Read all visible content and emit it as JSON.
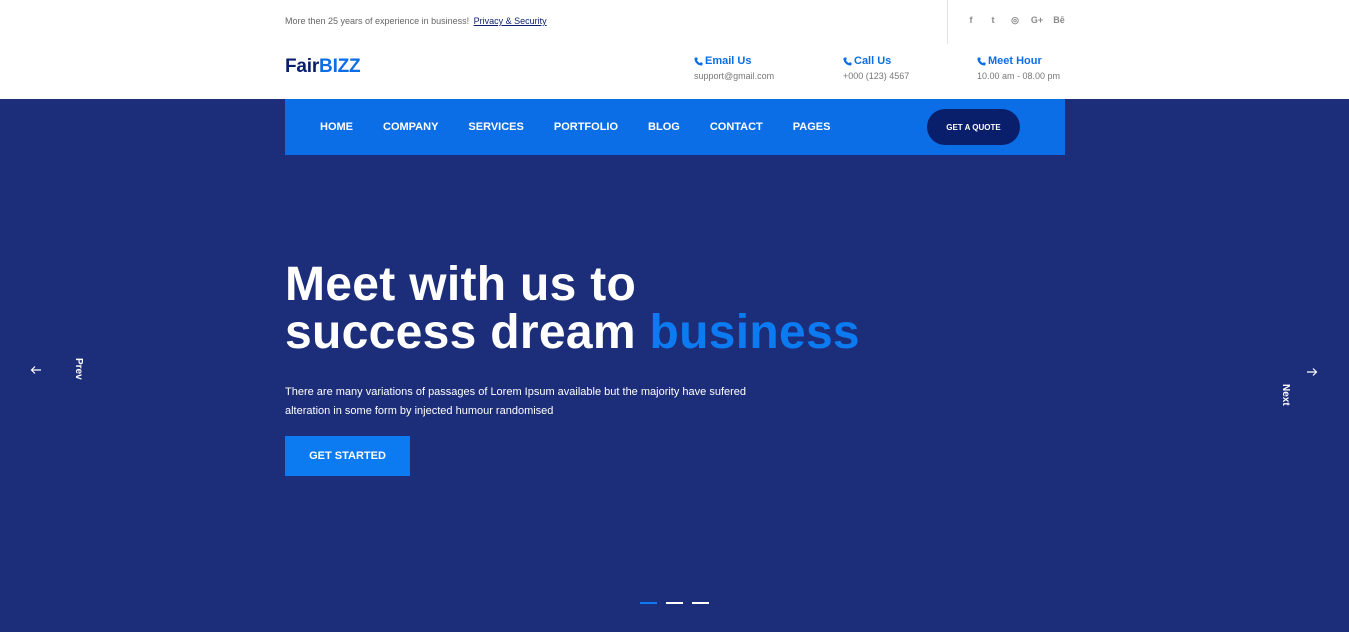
{
  "topbar": {
    "tagline": "More then 25 years of experience in business!",
    "link": "Privacy & Security",
    "socials": [
      {
        "icon": "facebook-icon",
        "glyph": "f"
      },
      {
        "icon": "twitter-icon",
        "glyph": "t"
      },
      {
        "icon": "instagram-icon",
        "glyph": "◎"
      },
      {
        "icon": "google-plus-icon",
        "glyph": "G+"
      },
      {
        "icon": "behance-icon",
        "glyph": "Bē"
      }
    ]
  },
  "header": {
    "logo_part1": "Fair",
    "logo_part2": "BIZZ",
    "contacts": [
      {
        "title": "Email Us",
        "value": "support@gmail.com",
        "icon": "phone-icon"
      },
      {
        "title": "Call Us",
        "value": "+000 (123) 4567",
        "icon": "phone-icon"
      },
      {
        "title": "Meet Hour",
        "value": "10.00 am - 08.00 pm",
        "icon": "phone-icon"
      }
    ]
  },
  "nav": {
    "items": [
      "HOME",
      "COMPANY",
      "SERVICES",
      "PORTFOLIO",
      "BLOG",
      "CONTACT",
      "PAGES"
    ],
    "quote_label": "GET A QUOTE"
  },
  "hero": {
    "title_line1": "Meet with us to",
    "title_line2": "success dream",
    "title_accent": "business",
    "description": "There are many variations of passages of Lorem Ipsum available but the majority have sufered alteration in some form by injected humour randomised",
    "cta_label": "GET STARTED",
    "prev_label": "Prev",
    "next_label": "Next",
    "slides_total": 3,
    "active_slide": 1
  },
  "colors": {
    "hero_bg": "#1c2d7a",
    "nav_bg": "#0c6ee6",
    "accent": "#0c7af0",
    "dark_navy": "#0a1f6b"
  }
}
